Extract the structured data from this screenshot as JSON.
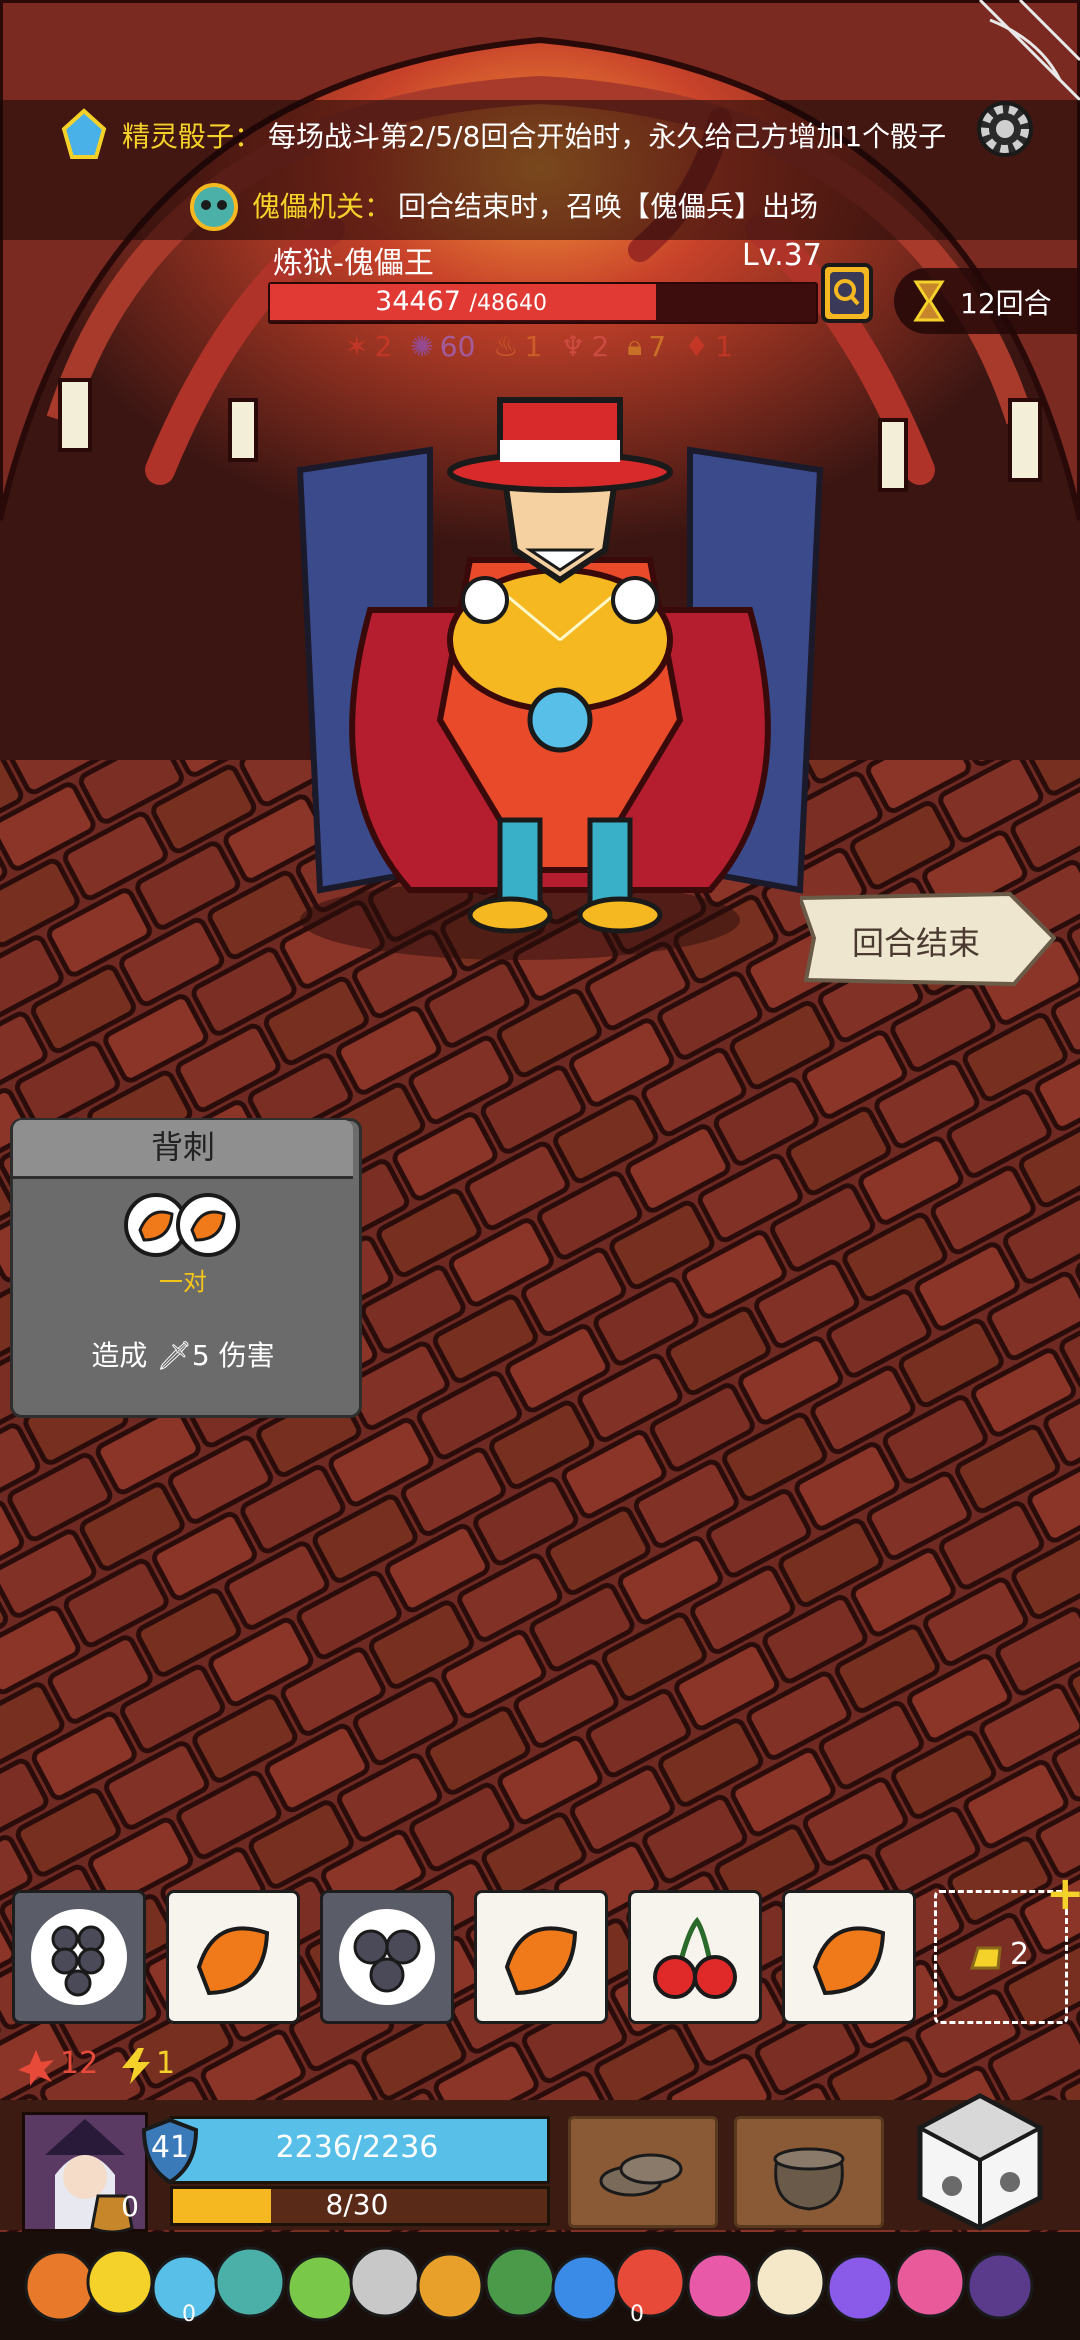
{
  "banners": [
    {
      "name": "精灵骰子：",
      "desc": "每场战斗第2/5/8回合开始时，永久给己方增加1个骰子",
      "icon": "crystal-icon"
    },
    {
      "name": "傀儡机关：",
      "desc": "回合结束时，召唤【傀儡兵】出场",
      "icon": "puppet-head-icon"
    }
  ],
  "boss": {
    "name": "炼狱-傀儡王",
    "level": "Lv.37",
    "hp_current": "34467",
    "hp_max": "/48640",
    "hp_fraction": 0.709,
    "statuses": [
      {
        "icon": "flame-icon",
        "value": "2",
        "color": "#e53a2a"
      },
      {
        "icon": "spark-icon",
        "value": "60",
        "color": "#8a5ae8"
      },
      {
        "icon": "fire-icon",
        "value": "1",
        "color": "#e8792a"
      },
      {
        "icon": "puppet-icon",
        "value": "2",
        "color": "#e85a5a"
      },
      {
        "icon": "lock-icon",
        "value": "7",
        "color": "#e8a02a"
      },
      {
        "icon": "blood-icon",
        "value": "1",
        "color": "#e53a2a"
      }
    ]
  },
  "round": {
    "label": "12回合"
  },
  "end_turn": {
    "label": "回合结束"
  },
  "skill_card": {
    "title": "背刺",
    "condition": "一对",
    "desc": "造成",
    "damage": "5 伤害"
  },
  "dice_slots": [
    {
      "type": "gray",
      "icon": "grapes-icon"
    },
    {
      "type": "white",
      "icon": "orange-slice-icon"
    },
    {
      "type": "gray",
      "icon": "blueberries-icon"
    },
    {
      "type": "white",
      "icon": "orange-slice-icon"
    },
    {
      "type": "white",
      "icon": "cherries-icon"
    },
    {
      "type": "white",
      "icon": "orange-slice-icon"
    }
  ],
  "extra_slot": {
    "count": "2",
    "plus": "+"
  },
  "player_stats": {
    "attack": "12",
    "energy": "1"
  },
  "player": {
    "shield": "41",
    "hp": "2236/2236",
    "xp": "8/30",
    "xp_fraction": 0.267,
    "gold": "0"
  },
  "relic_counts": [
    "0",
    "0"
  ],
  "colors": {
    "accent": "#f5d22a",
    "hp_red": "#e13a34",
    "hp_blue": "#58bfe8",
    "xp_yellow": "#f5b820"
  }
}
